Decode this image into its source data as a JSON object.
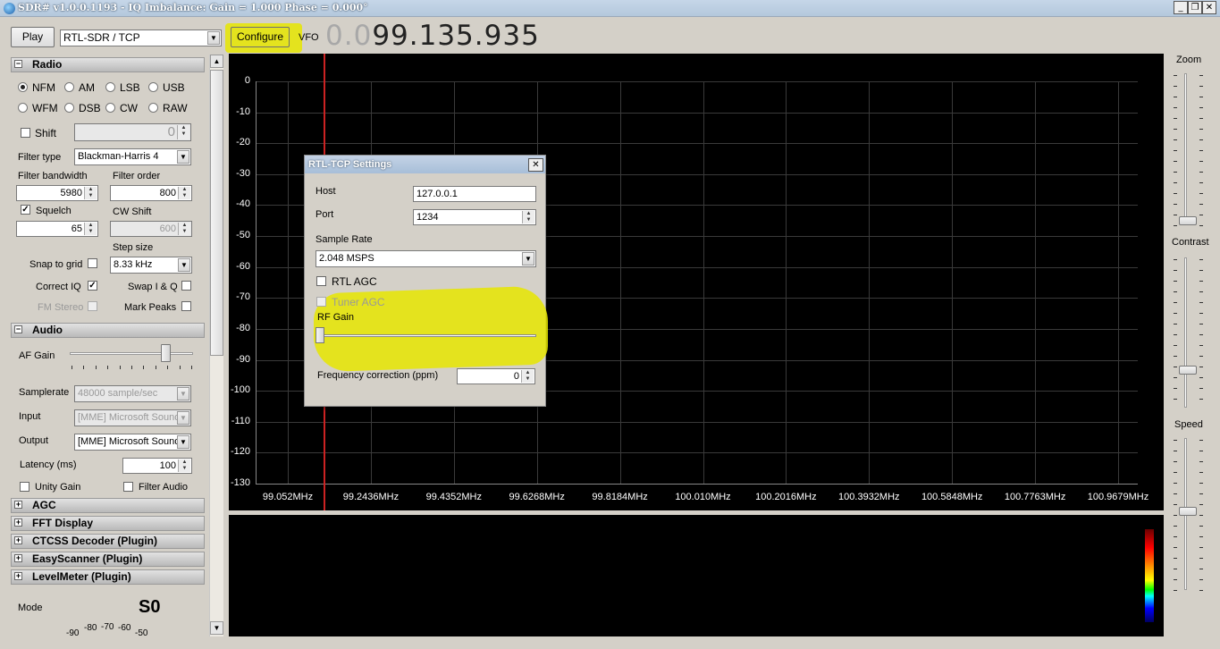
{
  "window": {
    "title": "SDR# v1.0.0.1193 - IQ Imbalance: Gain = 1.000 Phase = 0.000°",
    "min": "_",
    "restore": "❐",
    "close": "✕"
  },
  "toolbar": {
    "play_label": "Play",
    "source": "RTL-SDR / TCP",
    "configure_label": "Configure",
    "vfo_label": "VFO",
    "frequency_dim": "0.0",
    "frequency": "99.135.935"
  },
  "radio": {
    "header": "Radio",
    "modes": [
      "NFM",
      "AM",
      "LSB",
      "USB",
      "WFM",
      "DSB",
      "CW",
      "RAW"
    ],
    "selected_mode": "NFM",
    "shift_label": "Shift",
    "shift_value": "0",
    "filter_type_label": "Filter type",
    "filter_type": "Blackman-Harris 4",
    "filter_bandwidth_label": "Filter bandwidth",
    "filter_bandwidth": "5980",
    "filter_order_label": "Filter order",
    "filter_order": "800",
    "squelch_label": "Squelch",
    "squelch_value": "65",
    "cw_shift_label": "CW Shift",
    "cw_shift_value": "600",
    "step_size_label": "Step size",
    "step_size": "8.33 kHz",
    "snap_label": "Snap to grid",
    "correct_iq_label": "Correct IQ",
    "swap_iq_label": "Swap I & Q",
    "fm_stereo_label": "FM Stereo",
    "mark_peaks_label": "Mark Peaks"
  },
  "audio": {
    "header": "Audio",
    "af_gain_label": "AF Gain",
    "samplerate_label": "Samplerate",
    "samplerate": "48000 sample/sec",
    "input_label": "Input",
    "input": "[MME] Microsoft Sound",
    "output_label": "Output",
    "output": "[MME] Microsoft Sound",
    "latency_label": "Latency (ms)",
    "latency": "100",
    "unity_gain_label": "Unity Gain",
    "filter_audio_label": "Filter Audio"
  },
  "sections": {
    "agc": "AGC",
    "fft": "FFT Display",
    "ctcss": "CTCSS Decoder (Plugin)",
    "easyscanner": "EasyScanner (Plugin)",
    "levelmeter": "LevelMeter (Plugin)"
  },
  "levelmeter": {
    "mode_label": "Mode",
    "value": "S0",
    "scale": [
      "-90",
      "-80",
      "-70",
      "-60",
      "-50"
    ]
  },
  "spectrum": {
    "y_ticks": [
      "0",
      "-10",
      "-20",
      "-30",
      "-40",
      "-50",
      "-60",
      "-70",
      "-80",
      "-90",
      "-100",
      "-110",
      "-120",
      "-130"
    ],
    "x_ticks": [
      "99.052MHz",
      "99.2436MHz",
      "99.4352MHz",
      "99.6268MHz",
      "99.8184MHz",
      "100.010MHz",
      "100.2016MHz",
      "100.3932MHz",
      "100.5848MHz",
      "100.7763MHz",
      "100.9679MHz"
    ]
  },
  "right_panel": {
    "zoom_label": "Zoom",
    "contrast_label": "Contrast",
    "speed_label": "Speed"
  },
  "dialog": {
    "title": "RTL-TCP Settings",
    "close": "✕",
    "host_label": "Host",
    "host": "127.0.0.1",
    "port_label": "Port",
    "port": "1234",
    "sample_rate_label": "Sample Rate",
    "sample_rate": "2.048 MSPS",
    "rtl_agc_label": "RTL AGC",
    "tuner_agc_label": "Tuner AGC",
    "rf_gain_label": "RF Gain",
    "freq_corr_label": "Frequency correction (ppm)",
    "freq_corr": "0"
  },
  "colors": {
    "highlight": "#e6e600",
    "vfo_line": "#cc2222",
    "background": "#d4d0c8"
  }
}
